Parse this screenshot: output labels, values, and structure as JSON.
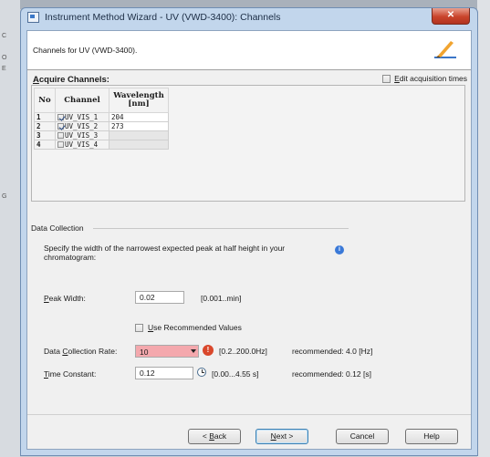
{
  "window": {
    "title": "Instrument Method Wizard - UV (VWD-3400): Channels",
    "close_glyph": "✕"
  },
  "background": {
    "marks": [
      "C",
      "O",
      "E",
      "G"
    ]
  },
  "header": {
    "text": "Channels for UV (VWD-3400)."
  },
  "acquire": {
    "label_first": "A",
    "label_rest": "cquire Channels:",
    "edit_times": {
      "first": "E",
      "rest": "dit acquisition times",
      "checked": false
    }
  },
  "channels": {
    "columns": {
      "no": "No",
      "channel": "Channel",
      "wavelength": "Wavelength [nm]"
    },
    "rows": [
      {
        "no": "1",
        "name": "UV_VIS_1",
        "checked": true,
        "wavelength": "204"
      },
      {
        "no": "2",
        "name": "UV_VIS_2",
        "checked": true,
        "wavelength": "273"
      },
      {
        "no": "3",
        "name": "UV_VIS_3",
        "checked": false,
        "wavelength": ""
      },
      {
        "no": "4",
        "name": "UV_VIS_4",
        "checked": false,
        "wavelength": ""
      }
    ]
  },
  "data_collection": {
    "title": "Data Collection",
    "help_text": "Specify the width of the narrowest expected peak at half height in your chromatogram:",
    "info_glyph": "i",
    "peak_width": {
      "label_first": "P",
      "label_rest": "eak Width:",
      "value": "0.02",
      "range": "[0.001..min]"
    },
    "use_recommended": {
      "label_first": "U",
      "label_rest": "se Recommended Values",
      "checked": false
    },
    "collection_rate": {
      "label_pre": "Data ",
      "label_first": "C",
      "label_rest": "ollection Rate:",
      "value": "10",
      "range": "[0.2..200.0Hz]",
      "recommended": "recommended: 4.0 [Hz]",
      "error_glyph": "!"
    },
    "time_constant": {
      "label_first": "T",
      "label_rest": "ime Constant:",
      "value": "0.12",
      "range": "[0.00...4.55 s]",
      "recommended": "recommended: 0.12 [s]"
    }
  },
  "buttons": {
    "back": {
      "prefix": "< ",
      "first": "B",
      "rest": "ack"
    },
    "next": {
      "first": "N",
      "rest": "ext >"
    },
    "cancel": "Cancel",
    "help": "Help"
  },
  "colors": {
    "error_field": "#f4a8ad",
    "title_bar": "#c2d6ec",
    "close_button": "#c9442b",
    "info_icon": "#3a79d8",
    "error_icon": "#d9472b"
  }
}
